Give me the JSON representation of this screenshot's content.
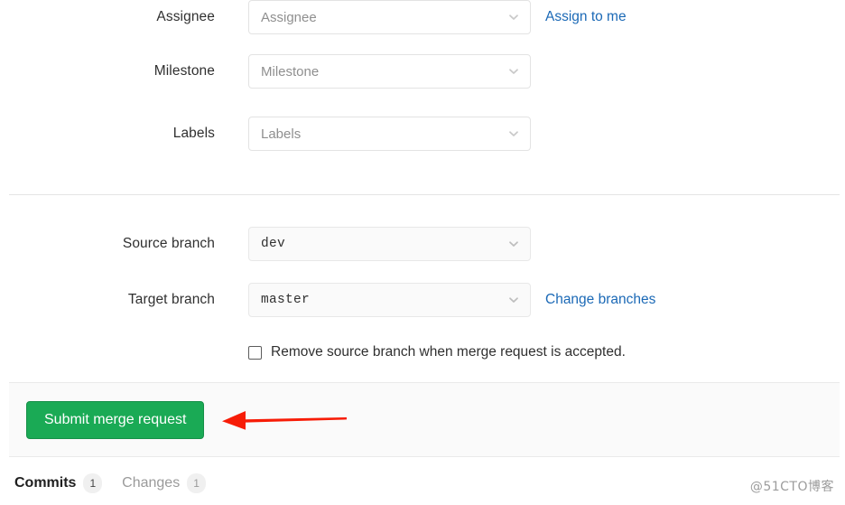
{
  "form": {
    "rows": [
      {
        "label": "Assignee",
        "value": "Assignee",
        "placeholder": "Assignee",
        "style": "plain",
        "link": "Assign to me",
        "icon": "chevron-down-icon"
      },
      {
        "label": "Milestone",
        "value": "Milestone",
        "placeholder": "Milestone",
        "style": "plain",
        "link": "",
        "icon": "chevron-down-icon"
      },
      {
        "label": "Labels",
        "value": "Labels",
        "placeholder": "Labels",
        "style": "plain",
        "link": "",
        "icon": "chevron-down-icon"
      }
    ],
    "branch_rows": [
      {
        "label": "Source branch",
        "value": "dev",
        "style": "branch",
        "link": "",
        "icon": "chevron-down-icon"
      },
      {
        "label": "Target branch",
        "value": "master",
        "style": "branch",
        "link": "Change branches",
        "icon": "chevron-down-icon"
      }
    ],
    "checkbox": {
      "label": "Remove source branch when merge request is accepted.",
      "checked": false
    }
  },
  "actions": {
    "submit_label": "Submit merge request"
  },
  "annotation": {
    "name": "red-arrow-pointing-left",
    "color": "#f71c07"
  },
  "tabs": [
    {
      "label": "Commits",
      "count": "1",
      "active": true
    },
    {
      "label": "Changes",
      "count": "1",
      "active": false
    }
  ],
  "watermark": {
    "text": "@51CTO博客"
  },
  "colors": {
    "submit_green": "#1aaa55",
    "link_blue": "#1b69b6",
    "panel_gray": "#fafafa",
    "border_gray": "#e5e5e5",
    "arrow_red": "#f71c07"
  }
}
